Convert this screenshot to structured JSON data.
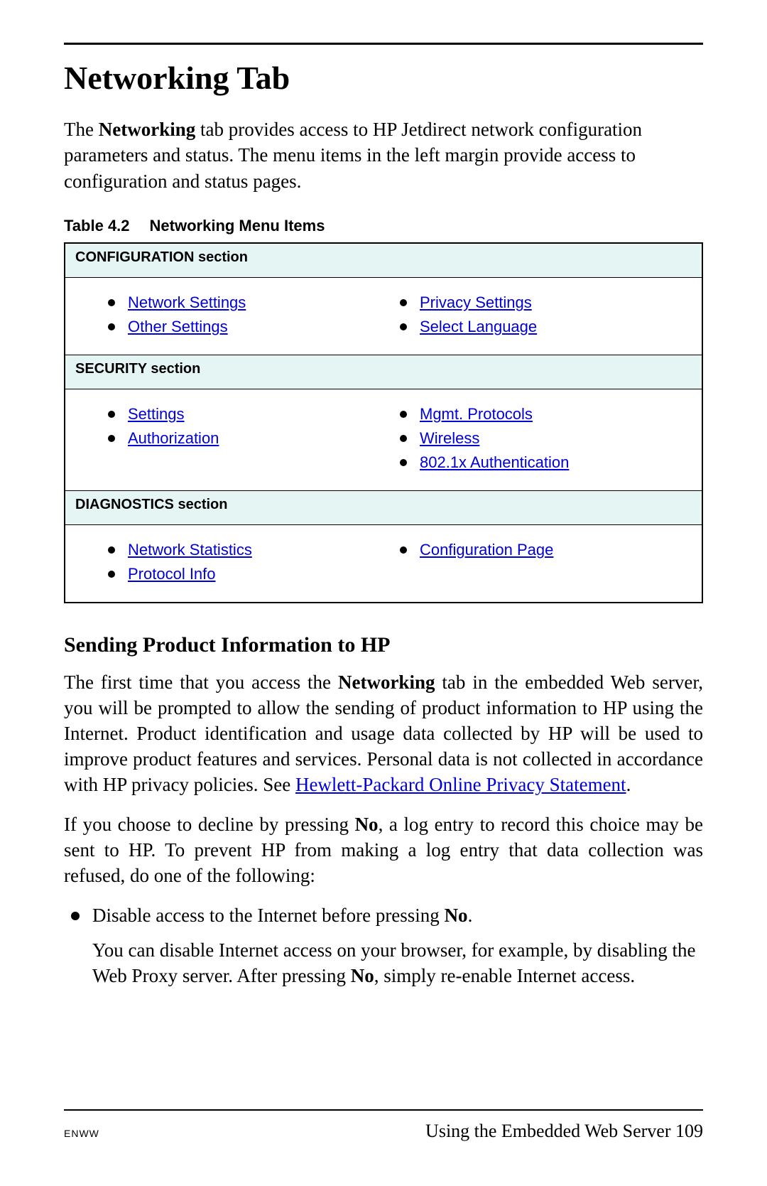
{
  "title": "Networking Tab",
  "intro": {
    "pre": "The ",
    "bold": "Networking",
    "post": " tab provides access to HP Jetdirect network configuration parameters and status. The menu items in the left margin provide access to configuration and status pages."
  },
  "table": {
    "caption_num": "Table 4.2",
    "caption_title": "Networking Menu Items",
    "sections": [
      {
        "header": "CONFIGURATION section",
        "left": [
          "Network Settings",
          "Other Settings"
        ],
        "right": [
          "Privacy Settings",
          "Select Language"
        ]
      },
      {
        "header": "SECURITY section",
        "left": [
          "Settings",
          "Authorization"
        ],
        "right": [
          "Mgmt. Protocols",
          "Wireless",
          "802.1x Authentication"
        ]
      },
      {
        "header": "DIAGNOSTICS section",
        "left": [
          "Network Statistics",
          "Protocol Info"
        ],
        "right": [
          "Configuration Page"
        ]
      }
    ]
  },
  "h2": "Sending Product Information to HP",
  "p1": {
    "t1": "The first time that you access the ",
    "b1": "Networking",
    "t2": " tab in the embedded Web server, you will be prompted to allow the sending of product information to HP using the Internet. Product identification and usage data collected by HP will be used to improve product features and services. Personal data is not collected in accordance with HP privacy policies. See ",
    "link": "Hewlett-Packard Online Privacy Statement",
    "t3": "."
  },
  "p2": {
    "t1": "If you choose to decline by pressing ",
    "b1": "No",
    "t2": ", a log entry to record this choice may be sent to HP. To prevent HP from making a log entry that data collection was refused, do one of the following:"
  },
  "bullet": {
    "t1": "Disable access to the Internet before pressing ",
    "b1": "No",
    "t2": "."
  },
  "subpara": {
    "t1": "You can disable Internet access on your browser, for example, by disabling the Web Proxy server. After pressing ",
    "b1": "No",
    "t2": ", simply re-enable Internet access."
  },
  "footer": {
    "left": "ENWW",
    "right_text": "Using the Embedded Web Server ",
    "page": "109"
  }
}
